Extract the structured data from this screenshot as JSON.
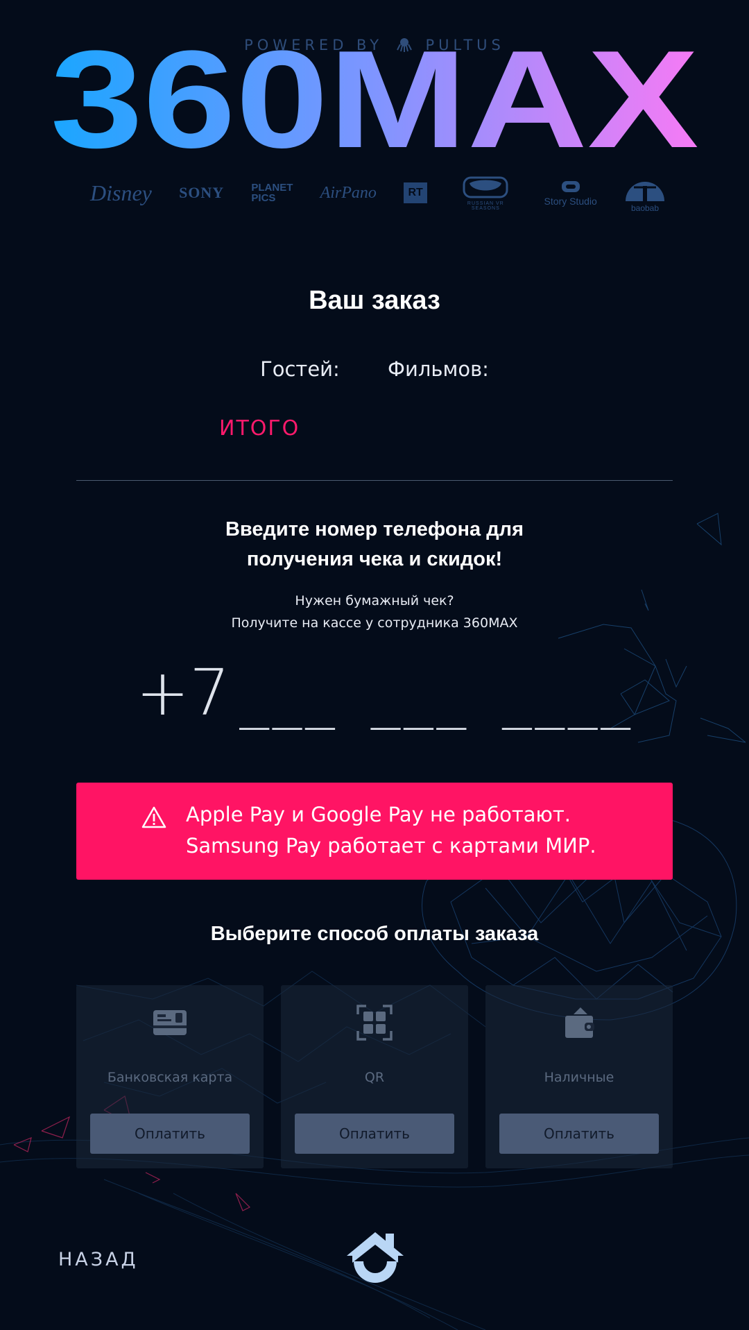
{
  "header": {
    "powered_by": "POWERED BY",
    "pultus": "PULTUS",
    "logo_text": "360MAX",
    "partners": [
      "Disney",
      "SONY",
      "PLANET PICS",
      "AirPano",
      "RT",
      "RUSSIAN VR SEASONS",
      "Story Studio",
      "baobab"
    ]
  },
  "order": {
    "title": "Ваш заказ",
    "guests_label": "Гостей:",
    "films_label": "Фильмов:",
    "total_label": "ИТОГО"
  },
  "phone": {
    "title_line1": "Введите номер телефона для",
    "title_line2": "получения чека и скидок!",
    "receipt_line1": "Нужен бумажный чек?",
    "receipt_line2": "Получите на кассе у сотрудника 360MAX",
    "prefix": "+7",
    "mask": "___ ___ ____"
  },
  "banner": {
    "line1": "Apple Pay и Google Pay не работают.",
    "line2": "Samsung Pay работает с картами МИР."
  },
  "payment": {
    "title": "Выберите способ оплаты заказа",
    "methods": [
      {
        "label": "Банковская карта",
        "button": "Оплатить",
        "icon": "credit-card-icon"
      },
      {
        "label": "QR",
        "button": "Оплатить",
        "icon": "qr-code-icon"
      },
      {
        "label": "Наличные",
        "button": "Оплатить",
        "icon": "wallet-icon"
      }
    ]
  },
  "footer": {
    "back": "НАЗАД",
    "home_icon": "home-icon"
  },
  "colors": {
    "background": "#040c1a",
    "accent_pink": "#ff1464",
    "logo_gradient_start": "#1aa6ff",
    "logo_gradient_end": "#f77af5",
    "button": "#4a5a76"
  }
}
